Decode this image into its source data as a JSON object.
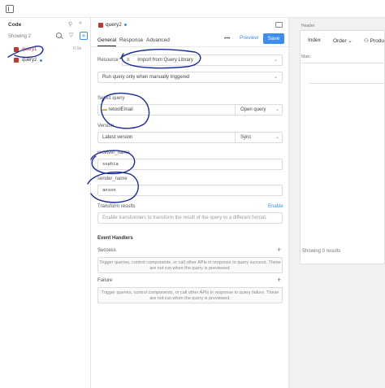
{
  "code_panel": {
    "title": "Code",
    "showing": "Showing 2",
    "queries": [
      {
        "name": "query1",
        "time": "0.9s"
      },
      {
        "name": "query2"
      }
    ]
  },
  "editor": {
    "query_name": "query2",
    "tabs": [
      "General",
      "Response",
      "Advanced"
    ],
    "preview_label": "Preview",
    "save_label": "Save",
    "resource_label": "Resource",
    "resource_value": "Import from Query Library",
    "trigger_value": "Run query only when manually triggered",
    "select_query_label": "Select query",
    "select_query_value": "retoolEmail",
    "open_query_label": "Open query",
    "version_label": "Version",
    "version_value": "Latest version",
    "sync_label": "Sync",
    "receiver_label": "receiver_name",
    "receiver_value": "sophia",
    "sender_label": "sender_name",
    "sender_value": "anson",
    "transform_label": "Transform results",
    "enable_label": "Enable",
    "transform_placeholder": "Enable transformers to transform the result of the query to a different format.",
    "event_handlers_label": "Event Handlers",
    "success_label": "Success",
    "success_text": "Trigger queries, control components, or call other APIs in response to query success. These are not run when the query is previewed.",
    "failure_label": "Failure",
    "failure_text": "Trigger queries, control components, or call other APIs in response to query failure. These are not run when the query is previewed."
  },
  "canvas": {
    "header_label": "Header",
    "nav": [
      "Index",
      "Order",
      "Produ"
    ],
    "main_label": "Main",
    "showing_results": "Showing 0 results"
  },
  "colors": {
    "accent": "#3b8ef0",
    "annotation": "#1a2a9e",
    "query_icon": "#c0392b"
  }
}
